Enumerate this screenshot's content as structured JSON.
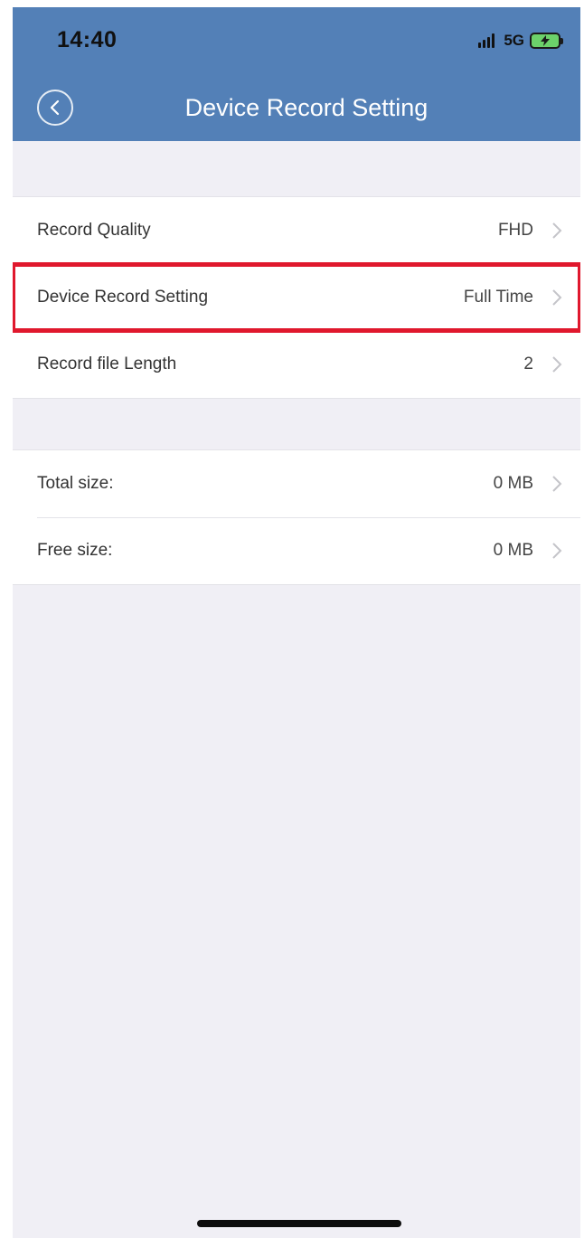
{
  "status_bar": {
    "time": "14:40",
    "network": "5G"
  },
  "header": {
    "title": "Device Record Setting"
  },
  "record_settings": [
    {
      "label": "Record Quality",
      "value": "FHD",
      "highlighted": false
    },
    {
      "label": "Device Record Setting",
      "value": "Full Time",
      "highlighted": true
    },
    {
      "label": "Record file Length",
      "value": "2",
      "highlighted": false
    }
  ],
  "storage": [
    {
      "label": "Total size:",
      "value": "0 MB"
    },
    {
      "label": "Free size:",
      "value": "0 MB"
    }
  ],
  "colors": {
    "header_bg": "#5380b7",
    "page_bg": "#f0eff5",
    "highlight_border": "#e0182d",
    "battery_fill": "#6cd16a"
  }
}
